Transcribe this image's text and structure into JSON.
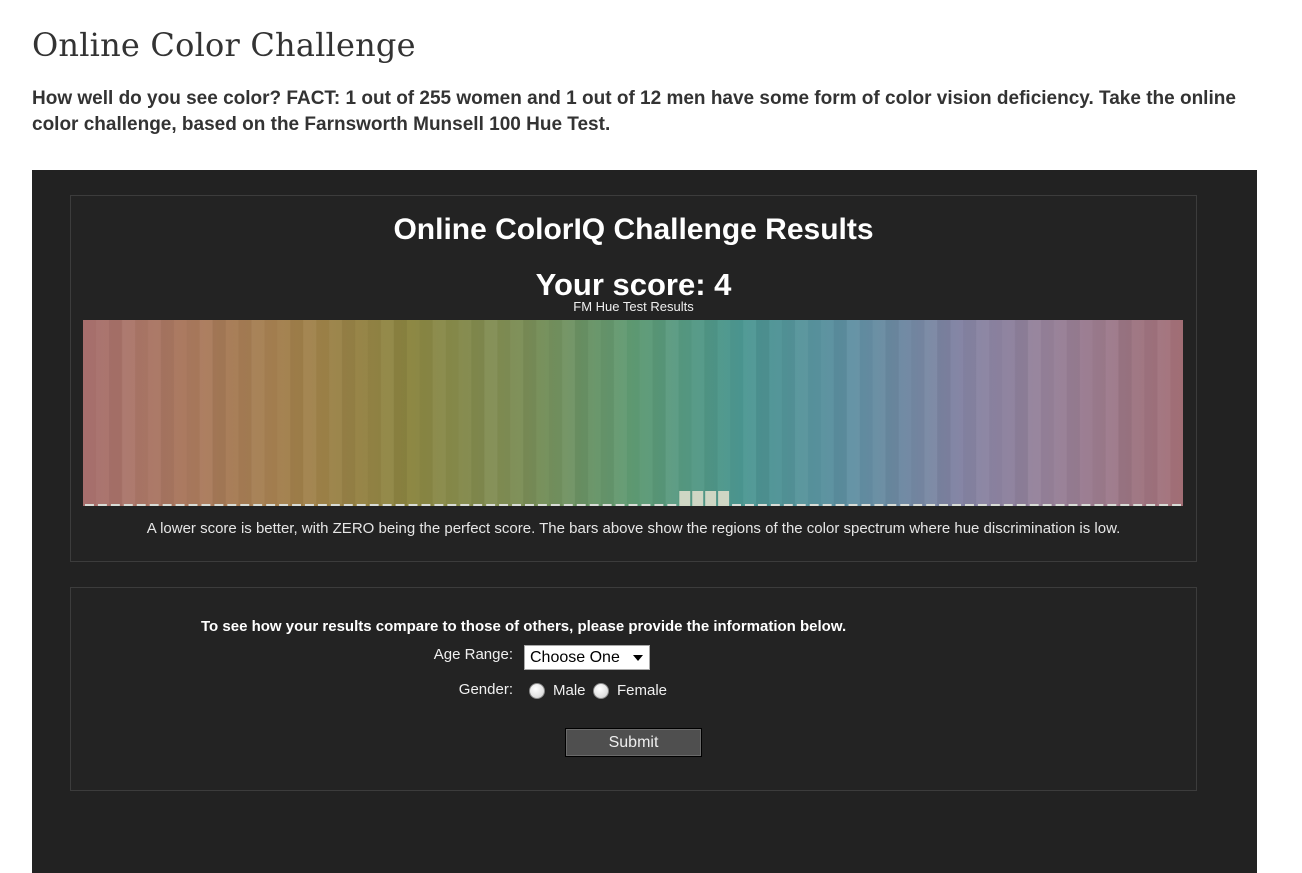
{
  "header": {
    "title": "Online Color Challenge",
    "intro": "How well do you see color? FACT: 1 out of 255 women and 1 out of 12 men have some form of color vision deficiency. Take the online color challenge, based on the Farnsworth Munsell 100 Hue Test."
  },
  "results": {
    "title": "Online ColorIQ Challenge Results",
    "score_text": "Your score: 4",
    "chart_caption": "FM Hue Test Results",
    "note": "A lower score is better, with ZERO being the perfect score. The bars above show the regions of the color spectrum where hue discrimination is low.",
    "spectrum_colors": [
      "#a8706f",
      "#ab7a5e",
      "#a1814a",
      "#8c8742",
      "#7c8e57",
      "#5f9a73",
      "#4c9893",
      "#5f8fa2",
      "#8584a4",
      "#9a7f95",
      "#a36f76"
    ],
    "bar_color": "#cfd6c4",
    "tick_color": "#d8dcd6"
  },
  "chart_data": {
    "type": "bar",
    "title": "FM Hue Test Results",
    "xlabel": "",
    "ylabel": "",
    "caps": 85,
    "error_caps": [
      46,
      47,
      48,
      49
    ],
    "values_note_text": ""
  },
  "form": {
    "prompt": "To see how your results compare to those of others, please provide the information below.",
    "age_label": "Age Range:",
    "age_selected": "Choose One",
    "gender_label": "Gender:",
    "gender_options": [
      "Male",
      "Female"
    ],
    "submit_label": "Submit"
  }
}
